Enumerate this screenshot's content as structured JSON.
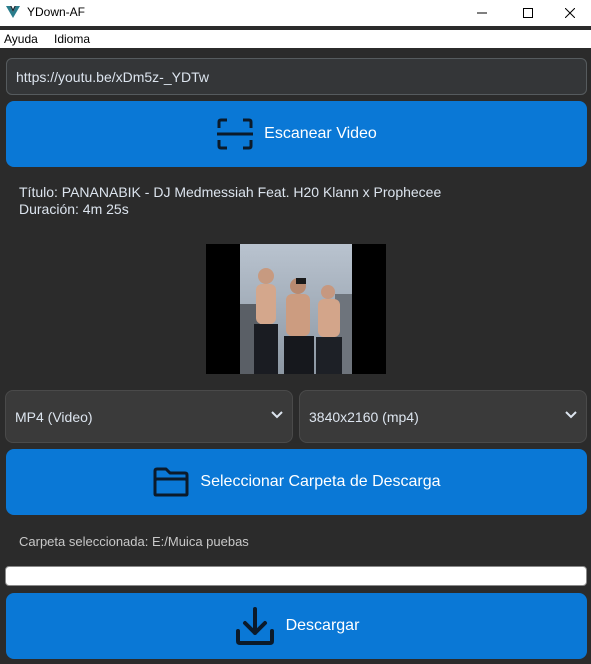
{
  "window": {
    "title": "YDown-AF"
  },
  "menu": {
    "items": [
      "Ayuda",
      "Idioma"
    ]
  },
  "url_input": {
    "value": "https://youtu.be/xDm5z-_YDTw"
  },
  "scan_button": {
    "label": "Escanear Video",
    "icon": "scan-icon"
  },
  "video": {
    "title_line": "Título: PANANABIK - DJ Medmessiah Feat. H20 Klann x Prophecee",
    "duration_line": "Duración: 4m 25s"
  },
  "format_select": {
    "value": "MP4 (Video)"
  },
  "resolution_select": {
    "value": "3840x2160 (mp4)"
  },
  "folder_button": {
    "label": "Seleccionar Carpeta de Descarga",
    "icon": "folder-icon"
  },
  "folder_label": "Carpeta seleccionada: E:/Muica puebas",
  "progress": {
    "value": 0
  },
  "download_button": {
    "label": "Descargar",
    "icon": "download-icon"
  },
  "colors": {
    "accent": "#0a78d6",
    "background": "#2b2b2b",
    "input_bg": "#343638",
    "select_bg": "#3a3a3a"
  }
}
